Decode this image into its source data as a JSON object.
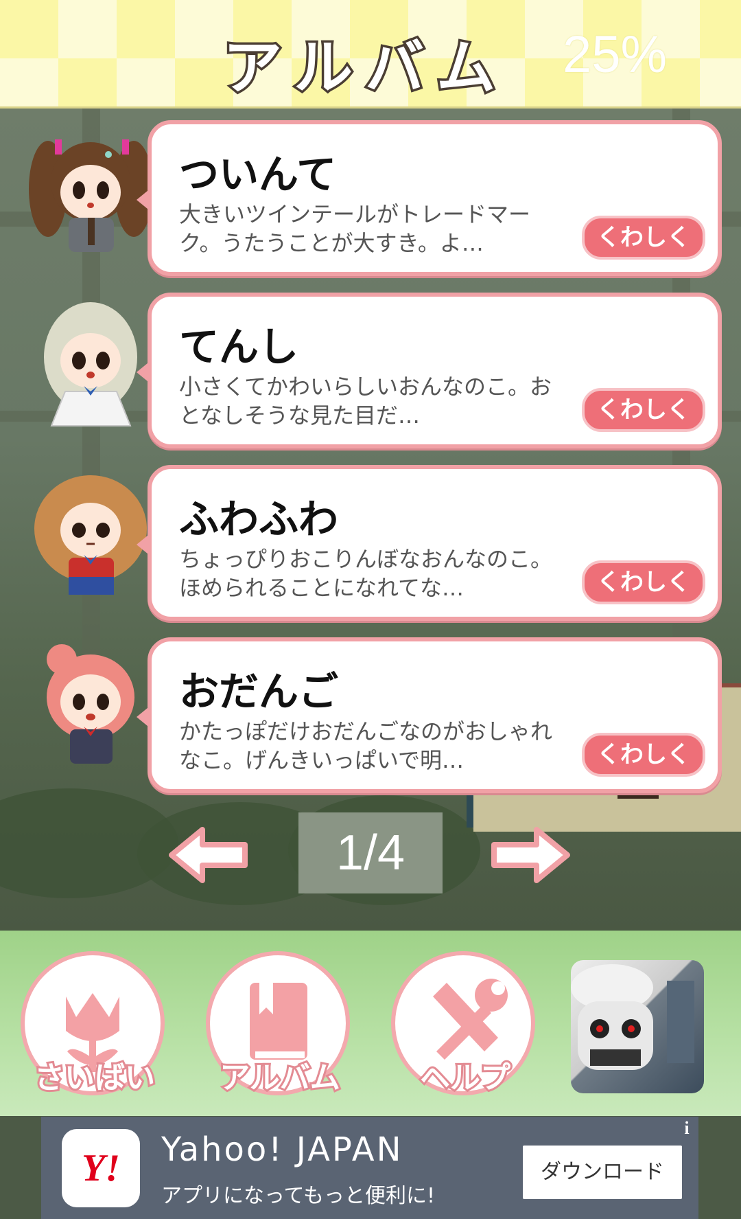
{
  "header": {
    "title": "アルバム",
    "percent": "25%"
  },
  "characters": [
    {
      "name": "ついんて",
      "description": "大きいツインテールがトレードマーク。うたうことが大すき。よ…",
      "more_label": "くわしく"
    },
    {
      "name": "てんし",
      "description": "小さくてかわいらしいおんなのこ。おとなしそうな見た目だ…",
      "more_label": "くわしく"
    },
    {
      "name": "ふわふわ",
      "description": "ちょっぴりおこりんぼなおんなのこ。ほめられることになれてな…",
      "more_label": "くわしく"
    },
    {
      "name": "おだんご",
      "description": "かたっぽだけおだんごなのがおしゃれなこ。げんきいっぱいで明…",
      "more_label": "くわしく"
    }
  ],
  "pager": {
    "label": "1/4"
  },
  "nav": {
    "items": [
      {
        "label": "さいばい",
        "icon": "tulip-icon"
      },
      {
        "label": "アルバム",
        "icon": "book-icon"
      },
      {
        "label": "ヘルプ",
        "icon": "tools-icon"
      }
    ]
  },
  "ad": {
    "logo": "Y!",
    "title": "Yahoo! JAPAN",
    "subtitle": "アプリになってもっと便利に!",
    "button": "ダウンロード",
    "info": "i"
  },
  "colors": {
    "card_border": "#f1a1a6",
    "button_pink": "#ee6f78",
    "header_yellow": "#fbf7a6",
    "nav_green": "#b6e0a3"
  }
}
